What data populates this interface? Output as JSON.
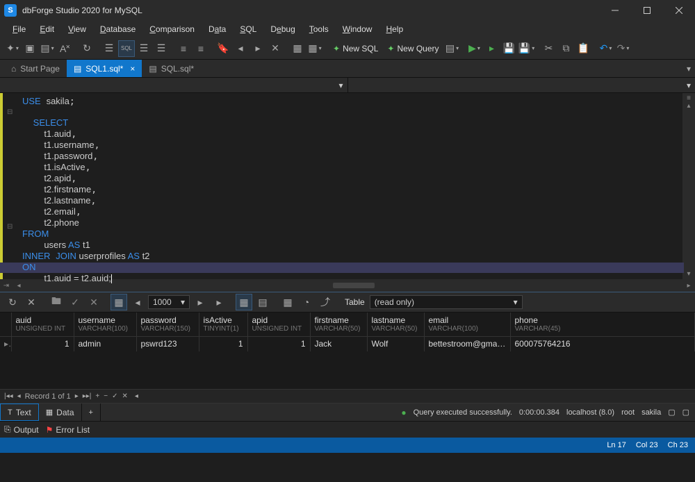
{
  "title": "dbForge Studio 2020 for MySQL",
  "menu": {
    "file": "File",
    "edit": "Edit",
    "view": "View",
    "database": "Database",
    "comparison": "Comparison",
    "data": "Data",
    "sql": "SQL",
    "debug": "Debug",
    "tools": "Tools",
    "window": "Window",
    "help": "Help"
  },
  "toolbar": {
    "new_sql": "New SQL",
    "new_query": "New Query",
    "sql_icon": "SQL"
  },
  "tabs": {
    "start": "Start Page",
    "t1": "SQL1.sql*",
    "t2": "SQL.sql*"
  },
  "code": {
    "l1_use": "USE",
    "l1_db": "sakila",
    "select": "SELECT",
    "c1": "t1.auid",
    "c2": "t1.username",
    "c3": "t1.password",
    "c4": "t1.isActive",
    "c5": "t2.apid",
    "c6": "t2.firstname",
    "c7": "t2.lastname",
    "c8": "t2.email",
    "c9": "t2.phone",
    "from": "FROM",
    "from_body": "users ",
    "as": "AS",
    "alias1": " t1",
    "inner": "INNER",
    "join": "JOIN",
    "join_body": " userprofiles ",
    "alias2": " t2",
    "on": "ON",
    "on_body": "t1.auid = t2.auid;"
  },
  "results_toolbar": {
    "page": "1000",
    "table": "Table",
    "readonly": "(read only)"
  },
  "columns": {
    "auid": {
      "h": "auid",
      "t": "UNSIGNED INT"
    },
    "username": {
      "h": "username",
      "t": "VARCHAR(100)"
    },
    "password": {
      "h": "password",
      "t": "VARCHAR(150)"
    },
    "isActive": {
      "h": "isActive",
      "t": "TINYINT(1)"
    },
    "apid": {
      "h": "apid",
      "t": "UNSIGNED INT"
    },
    "firstname": {
      "h": "firstname",
      "t": "VARCHAR(50)"
    },
    "lastname": {
      "h": "lastname",
      "t": "VARCHAR(50)"
    },
    "email": {
      "h": "email",
      "t": "VARCHAR(100)"
    },
    "phone": {
      "h": "phone",
      "t": "VARCHAR(45)"
    }
  },
  "row": {
    "auid": "1",
    "username": "admin",
    "password": "pswrd123",
    "isActive": "1",
    "apid": "1",
    "firstname": "Jack",
    "lastname": "Wolf",
    "email": "bettestroom@gmail.com",
    "phone": "600075764216"
  },
  "gridnav": {
    "record": "Record 1 of 1"
  },
  "bottom": {
    "text": "Text",
    "data": "Data"
  },
  "status_exec": {
    "msg": "Query executed successfully.",
    "time": "0:00:00.384",
    "host": "localhost (8.0)",
    "user": "root",
    "db": "sakila"
  },
  "output": {
    "out": "Output",
    "err": "Error List"
  },
  "statusbar": {
    "ln": "Ln 17",
    "col": "Col 23",
    "ch": "Ch 23"
  }
}
